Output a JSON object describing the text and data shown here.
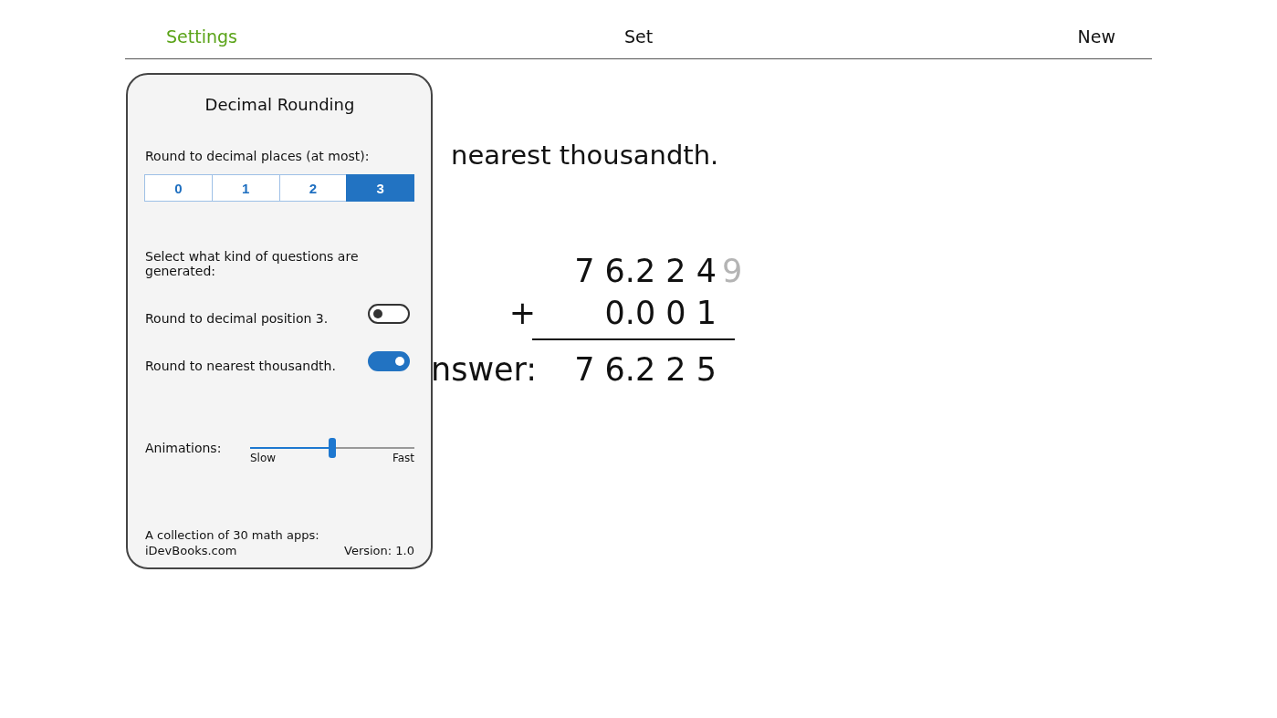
{
  "nav": [
    {
      "label": "Settings",
      "selected": true
    },
    {
      "label": "Set",
      "selected": false
    },
    {
      "label": "New",
      "selected": false
    }
  ],
  "problem": {
    "question": "nearest thousandth.",
    "rows": [
      {
        "op": "",
        "digits": "7 6.2 2 4",
        "faded": "9"
      },
      {
        "op": "+",
        "digits": "0.0 0 1",
        "faded": ""
      }
    ],
    "answer_label": "nswer:",
    "answer": "7 6.2 2 5"
  },
  "settings_panel": {
    "title": "Decimal Rounding",
    "places_label": "Round to decimal places (at most):",
    "places": [
      {
        "label": "0",
        "selected": false
      },
      {
        "label": "1",
        "selected": false
      },
      {
        "label": "2",
        "selected": false
      },
      {
        "label": "3",
        "selected": true
      }
    ],
    "kinds_label": "Select what kind of questions are generated:",
    "question_kinds": [
      {
        "label": "Round to decimal position 3.",
        "on": false
      },
      {
        "label": "Round to nearest thousandth.",
        "on": true
      }
    ],
    "animations": {
      "label": "Animations:",
      "level": 0.5,
      "min_label": "Slow",
      "max_label": "Fast"
    },
    "footer": {
      "collection": "A collection of 30 math apps:",
      "link": "iDevBooks.com",
      "version": "Version: 1.0"
    }
  }
}
